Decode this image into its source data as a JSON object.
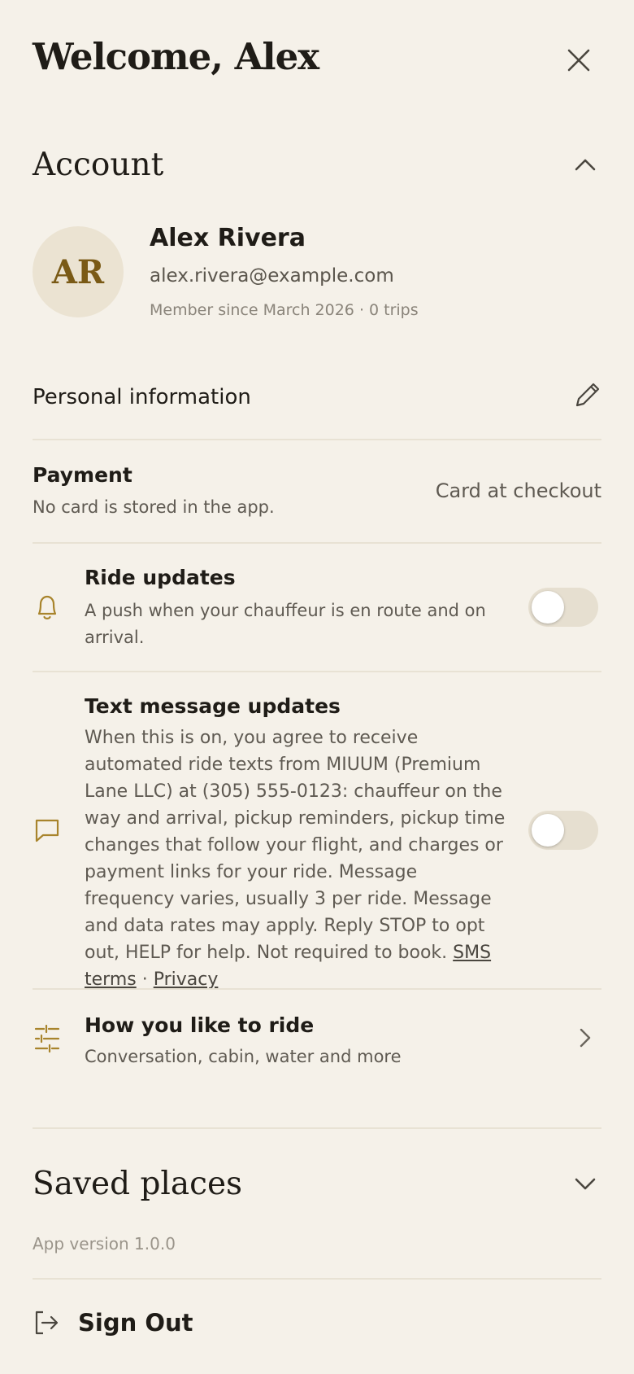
{
  "header": {
    "title": "Welcome, Alex"
  },
  "account": {
    "section_title": "Account",
    "avatar_initials": "AR",
    "name": "Alex Rivera",
    "email": "alex.rivera@example.com",
    "member_line": "Member since March 2026 · 0 trips"
  },
  "personal_info": {
    "label": "Personal information"
  },
  "payment": {
    "title": "Payment",
    "subtitle": "No card is stored in the app.",
    "value": "Card at checkout"
  },
  "ride_updates": {
    "title": "Ride updates",
    "subtitle": "A push when your chauffeur is en route and on arrival.",
    "enabled": false
  },
  "text_updates": {
    "title": "Text message updates",
    "body": "When this is on, you agree to receive automated ride texts from MIUUM (Premium Lane LLC) at (305) 555-0123: chauffeur on the way and arrival, pickup reminders, pickup time changes that follow your flight, and charges or payment links for your ride. Message frequency varies, usually 3 per ride. Message and data rates may apply. Reply STOP to opt out, HELP for help. Not required to book.",
    "sms_terms_link": "SMS terms",
    "separator": "·",
    "privacy_link": "Privacy",
    "enabled": false
  },
  "ride_prefs": {
    "title": "How you like to ride",
    "subtitle": "Conversation, cabin, water and more"
  },
  "saved_places": {
    "section_title": "Saved places"
  },
  "footer": {
    "version": "App version 1.0.0",
    "sign_out": "Sign Out"
  },
  "colors": {
    "background": "#f5f1e9",
    "accent_gold": "#a8842c",
    "avatar_bg": "#ebe3d2",
    "toggle_off": "#e6dfd0"
  },
  "icons": {
    "close": "close-icon",
    "chevron_up": "chevron-up-icon",
    "pencil": "pencil-icon",
    "bell": "bell-icon",
    "message": "message-icon",
    "sliders": "sliders-icon",
    "chevron_right": "chevron-right-icon",
    "chevron_down": "chevron-down-icon",
    "sign_out": "sign-out-icon"
  }
}
